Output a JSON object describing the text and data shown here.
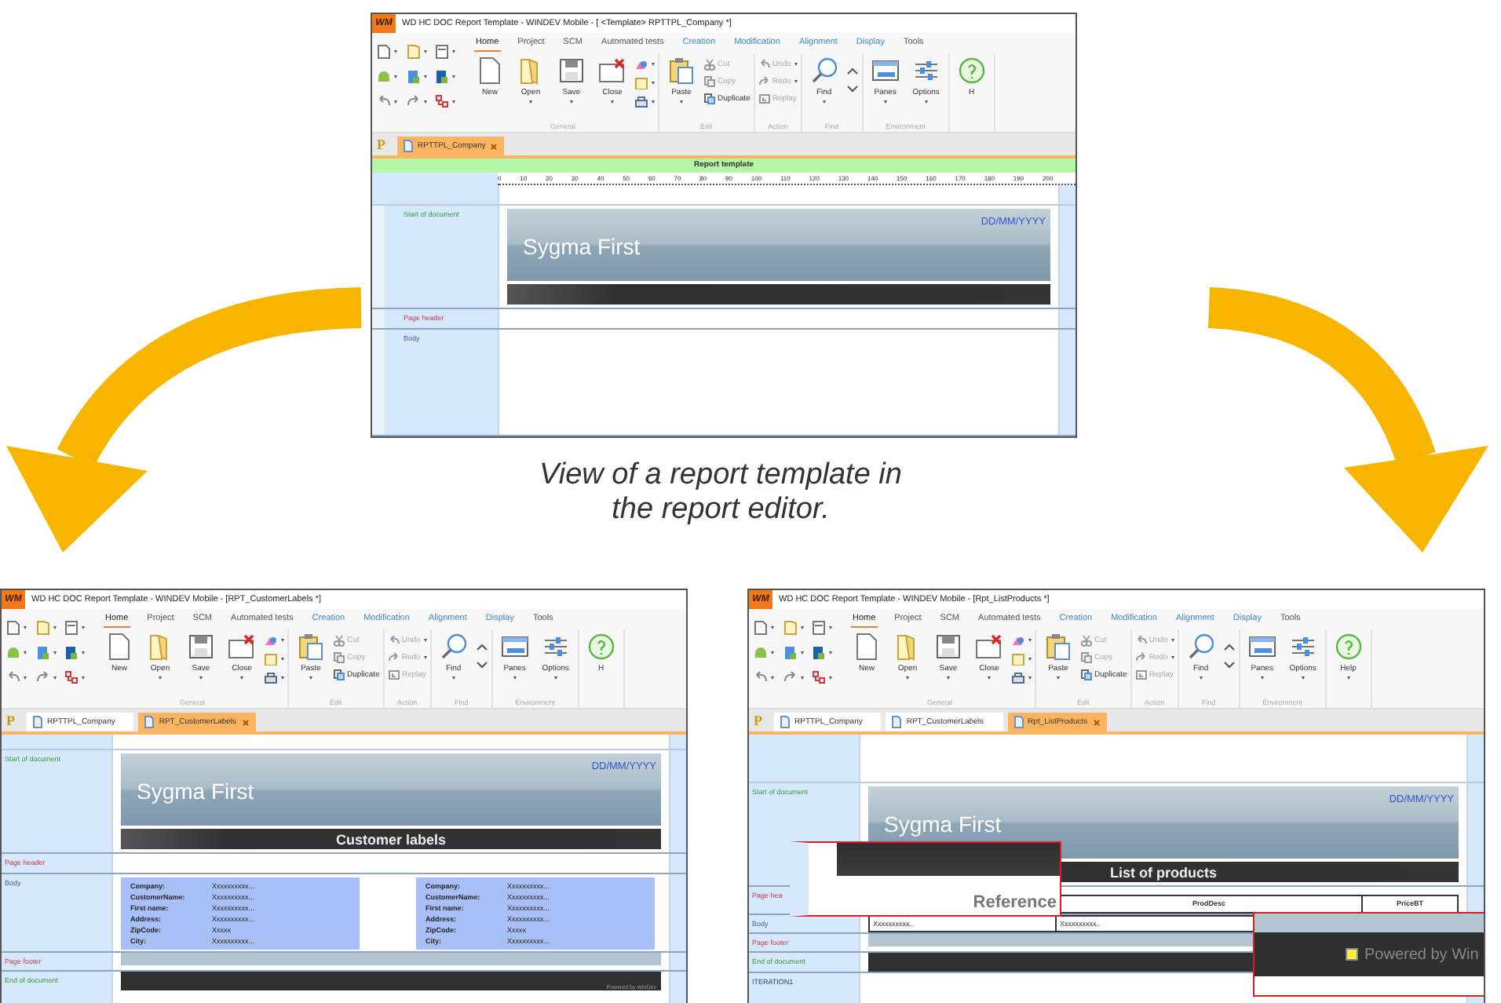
{
  "caption": "View of a report template in the report editor.",
  "windows": [
    {
      "logo": "WM",
      "title": "WD HC DOC Report Template - WINDEV Mobile - [ <Template> RPTTPL_Company *]",
      "ribbon_tabs": [
        {
          "label": "Home",
          "selected": true,
          "kind": "standard"
        },
        {
          "label": "Project",
          "selected": false,
          "kind": "standard"
        },
        {
          "label": "SCM",
          "selected": false,
          "kind": "standard"
        },
        {
          "label": "Automated tests",
          "selected": false,
          "kind": "standard"
        },
        {
          "label": "Creation",
          "selected": false,
          "kind": "contextual"
        },
        {
          "label": "Modification",
          "selected": false,
          "kind": "contextual"
        },
        {
          "label": "Alignment",
          "selected": false,
          "kind": "contextual"
        },
        {
          "label": "Display",
          "selected": false,
          "kind": "contextual"
        },
        {
          "label": "Tools",
          "selected": false,
          "kind": "standard"
        }
      ],
      "ribbon_groups": [
        {
          "label": "General",
          "buttons": [
            {
              "label": "New",
              "kind": "large",
              "dropdown": false,
              "disabled": false
            },
            {
              "label": "Open",
              "kind": "large",
              "dropdown": true,
              "disabled": false
            },
            {
              "label": "Save",
              "kind": "large",
              "dropdown": true,
              "disabled": false
            },
            {
              "label": "Close",
              "kind": "large",
              "dropdown": true,
              "disabled": false
            }
          ]
        },
        {
          "label": "Edit",
          "buttons": [
            {
              "label": "Paste",
              "kind": "large",
              "dropdown": true,
              "disabled": false
            },
            {
              "label": "Cut",
              "kind": "small",
              "dropdown": false,
              "disabled": true
            },
            {
              "label": "Copy",
              "kind": "small",
              "dropdown": false,
              "disabled": true
            },
            {
              "label": "Duplicate",
              "kind": "small",
              "dropdown": false,
              "disabled": false
            }
          ]
        },
        {
          "label": "Action",
          "buttons": [
            {
              "label": "Undo",
              "kind": "small",
              "dropdown": true,
              "disabled": true
            },
            {
              "label": "Redo",
              "kind": "small",
              "dropdown": true,
              "disabled": true
            },
            {
              "label": "Replay",
              "kind": "small",
              "dropdown": false,
              "disabled": true
            }
          ]
        },
        {
          "label": "Find",
          "buttons": [
            {
              "label": "Find",
              "kind": "large",
              "dropdown": true,
              "disabled": false
            }
          ]
        },
        {
          "label": "Environment",
          "buttons": [
            {
              "label": "Panes",
              "kind": "large",
              "dropdown": true,
              "disabled": false
            },
            {
              "label": "Options",
              "kind": "large",
              "dropdown": true,
              "disabled": false
            }
          ]
        },
        {
          "buttons": [
            {
              "label": "H",
              "kind": "large",
              "dropdown": false,
              "disabled": false
            }
          ]
        }
      ],
      "project_badge": "P",
      "doc_tabs": [
        {
          "label": "RPTTPL_Company",
          "selected": true
        }
      ],
      "band_title": "Report template",
      "ruler": [
        "0",
        "10",
        "20",
        "30",
        "40",
        "50",
        "60",
        "70",
        "80",
        "90",
        "100",
        "110",
        "120",
        "130",
        "140",
        "150",
        "160",
        "170",
        "180",
        "190",
        "200"
      ],
      "sections": [
        {
          "label": "Start of document",
          "kind": "start",
          "blocks": [
            {
              "kind": "header",
              "title": "Sygma First",
              "date": "DD/MM/YYYY"
            },
            {
              "kind": "bar"
            }
          ]
        },
        {
          "label": "Page header",
          "kind": "header"
        },
        {
          "label": "Body",
          "kind": "body"
        }
      ]
    },
    {
      "logo": "WM",
      "title": "WD HC DOC Report Template - WINDEV Mobile - [RPT_CustomerLabels *]",
      "ribbon_tabs": [
        {
          "label": "Home",
          "selected": true,
          "kind": "standard"
        },
        {
          "label": "Project",
          "selected": false,
          "kind": "standard"
        },
        {
          "label": "SCM",
          "selected": false,
          "kind": "standard"
        },
        {
          "label": "Automated tests",
          "selected": false,
          "kind": "standard"
        },
        {
          "label": "Creation",
          "selected": false,
          "kind": "contextual"
        },
        {
          "label": "Modification",
          "selected": false,
          "kind": "contextual"
        },
        {
          "label": "Alignment",
          "selected": false,
          "kind": "contextual"
        },
        {
          "label": "Display",
          "selected": false,
          "kind": "contextual"
        },
        {
          "label": "Tools",
          "selected": false,
          "kind": "standard"
        }
      ],
      "ribbon_groups": [
        {
          "label": "General",
          "buttons": [
            {
              "label": "New",
              "kind": "large",
              "dropdown": false,
              "disabled": false
            },
            {
              "label": "Open",
              "kind": "large",
              "dropdown": true,
              "disabled": false
            },
            {
              "label": "Save",
              "kind": "large",
              "dropdown": true,
              "disabled": false
            },
            {
              "label": "Close",
              "kind": "large",
              "dropdown": true,
              "disabled": false
            }
          ]
        },
        {
          "label": "Edit",
          "buttons": [
            {
              "label": "Paste",
              "kind": "large",
              "dropdown": true,
              "disabled": false
            },
            {
              "label": "Cut",
              "kind": "small",
              "dropdown": false,
              "disabled": true
            },
            {
              "label": "Copy",
              "kind": "small",
              "dropdown": false,
              "disabled": true
            },
            {
              "label": "Duplicate",
              "kind": "small",
              "dropdown": false,
              "disabled": false
            }
          ]
        },
        {
          "label": "Action",
          "buttons": [
            {
              "label": "Undo",
              "kind": "small",
              "dropdown": true,
              "disabled": true
            },
            {
              "label": "Redo",
              "kind": "small",
              "dropdown": true,
              "disabled": true
            },
            {
              "label": "Replay",
              "kind": "small",
              "dropdown": false,
              "disabled": true
            }
          ]
        },
        {
          "label": "Find",
          "buttons": [
            {
              "label": "Find",
              "kind": "large",
              "dropdown": true,
              "disabled": false
            }
          ]
        },
        {
          "label": "Environment",
          "buttons": [
            {
              "label": "Panes",
              "kind": "large",
              "dropdown": true,
              "disabled": false
            },
            {
              "label": "Options",
              "kind": "large",
              "dropdown": true,
              "disabled": false
            }
          ]
        },
        {
          "buttons": [
            {
              "label": "H",
              "kind": "large",
              "dropdown": false,
              "disabled": false
            }
          ]
        }
      ],
      "project_badge": "P",
      "doc_tabs": [
        {
          "label": "RPTTPL_Company",
          "selected": false
        },
        {
          "label": "RPT_CustomerLabels",
          "selected": true
        }
      ],
      "sections": [
        {
          "label": "Start of document",
          "kind": "start",
          "blocks": [
            {
              "kind": "header",
              "title": "Sygma First",
              "date": "DD/MM/YYYY"
            },
            {
              "kind": "bar",
              "text": "Customer labels"
            }
          ]
        },
        {
          "label": "Page header",
          "kind": "header"
        },
        {
          "label": "Body",
          "kind": "body",
          "blocks": [
            {
              "kind": "labels",
              "cards": [
                {
                  "fields": [
                    {
                      "name": "Company:",
                      "value": "Xxxxxxxxxx..."
                    },
                    {
                      "name": "CustomerName:",
                      "value": "Xxxxxxxxxx..."
                    },
                    {
                      "name": "First name:",
                      "value": "Xxxxxxxxxx..."
                    },
                    {
                      "name": "Address:",
                      "value": "Xxxxxxxxxx..."
                    },
                    {
                      "name": "ZipCode:",
                      "value": "Xxxxx"
                    },
                    {
                      "name": "City:",
                      "value": "Xxxxxxxxxx..."
                    }
                  ]
                },
                {
                  "fields": [
                    {
                      "name": "Company:",
                      "value": "Xxxxxxxxxx..."
                    },
                    {
                      "name": "CustomerName:",
                      "value": "Xxxxxxxxxx..."
                    },
                    {
                      "name": "First name:",
                      "value": "Xxxxxxxxxx..."
                    },
                    {
                      "name": "Address:",
                      "value": "Xxxxxxxxxx..."
                    },
                    {
                      "name": "ZipCode:",
                      "value": "Xxxxx"
                    },
                    {
                      "name": "City:",
                      "value": "Xxxxxxxxxx..."
                    }
                  ]
                }
              ]
            }
          ]
        },
        {
          "label": "Page footer",
          "kind": "footer",
          "blocks": [
            {
              "kind": "footer"
            }
          ]
        },
        {
          "label": "End of document",
          "kind": "end",
          "blocks": [
            {
              "kind": "end-bar",
              "text": "Powered by WinDev"
            }
          ]
        }
      ]
    },
    {
      "logo": "WM",
      "title": "WD HC DOC Report Template - WINDEV Mobile - [Rpt_ListProducts *]",
      "ribbon_tabs": [
        {
          "label": "Home",
          "selected": true,
          "kind": "standard"
        },
        {
          "label": "Project",
          "selected": false,
          "kind": "standard"
        },
        {
          "label": "SCM",
          "selected": false,
          "kind": "standard"
        },
        {
          "label": "Automated tests",
          "selected": false,
          "kind": "standard"
        },
        {
          "label": "Creation",
          "selected": false,
          "kind": "contextual"
        },
        {
          "label": "Modification",
          "selected": false,
          "kind": "contextual"
        },
        {
          "label": "Alignment",
          "selected": false,
          "kind": "contextual"
        },
        {
          "label": "Display",
          "selected": false,
          "kind": "contextual"
        },
        {
          "label": "Tools",
          "selected": false,
          "kind": "standard"
        }
      ],
      "ribbon_groups": [
        {
          "label": "General",
          "buttons": [
            {
              "label": "New",
              "kind": "large",
              "dropdown": false,
              "disabled": false
            },
            {
              "label": "Open",
              "kind": "large",
              "dropdown": true,
              "disabled": false
            },
            {
              "label": "Save",
              "kind": "large",
              "dropdown": true,
              "disabled": false
            },
            {
              "label": "Close",
              "kind": "large",
              "dropdown": true,
              "disabled": false
            }
          ]
        },
        {
          "label": "Edit",
          "buttons": [
            {
              "label": "Paste",
              "kind": "large",
              "dropdown": true,
              "disabled": false
            },
            {
              "label": "Cut",
              "kind": "small",
              "dropdown": false,
              "disabled": true
            },
            {
              "label": "Copy",
              "kind": "small",
              "dropdown": false,
              "disabled": true
            },
            {
              "label": "Duplicate",
              "kind": "small",
              "dropdown": false,
              "disabled": false
            }
          ]
        },
        {
          "label": "Action",
          "buttons": [
            {
              "label": "Undo",
              "kind": "small",
              "dropdown": true,
              "disabled": true
            },
            {
              "label": "Redo",
              "kind": "small",
              "dropdown": true,
              "disabled": true
            },
            {
              "label": "Replay",
              "kind": "small",
              "dropdown": false,
              "disabled": true
            }
          ]
        },
        {
          "label": "Find",
          "buttons": [
            {
              "label": "Find",
              "kind": "large",
              "dropdown": true,
              "disabled": false
            }
          ]
        },
        {
          "label": "Environment",
          "buttons": [
            {
              "label": "Panes",
              "kind": "large",
              "dropdown": true,
              "disabled": false
            },
            {
              "label": "Options",
              "kind": "large",
              "dropdown": true,
              "disabled": false
            }
          ]
        },
        {
          "buttons": [
            {
              "label": "Help",
              "kind": "large",
              "dropdown": true,
              "disabled": false
            }
          ]
        }
      ],
      "project_badge": "P",
      "doc_tabs": [
        {
          "label": "RPTTPL_Company",
          "selected": false
        },
        {
          "label": "RPT_CustomerLabels",
          "selected": false
        },
        {
          "label": "Rpt_ListProducts",
          "selected": true
        }
      ],
      "sections": [
        {
          "label": "Start of document",
          "kind": "start",
          "blocks": [
            {
              "kind": "header",
              "title": "Sygma First",
              "date": "DD/MM/YYYY"
            },
            {
              "kind": "bar",
              "text": "List of products"
            }
          ]
        },
        {
          "label": "Page hea",
          "kind": "header",
          "blocks": [
            {
              "kind": "table-head",
              "cells": [
                "ProdDesc",
                "PriceBT"
              ]
            }
          ]
        },
        {
          "label": "Body",
          "kind": "body",
          "blocks": [
            {
              "kind": "table-body",
              "cells": [
                "Xxxxxxxxxx..",
                "Xxxxxxxxxx.."
              ]
            }
          ]
        },
        {
          "label": "Page footer",
          "kind": "footer",
          "blocks": [
            {
              "kind": "footer"
            }
          ]
        },
        {
          "label": "End of document",
          "kind": "end",
          "blocks": [
            {
              "kind": "end-bar"
            }
          ]
        },
        {
          "label": "ITERATION1",
          "kind": "iteration"
        }
      ],
      "callouts": [
        {
          "kind": "reference",
          "text": "Reference"
        },
        {
          "kind": "powered",
          "text": "Powered by Win"
        }
      ]
    }
  ]
}
